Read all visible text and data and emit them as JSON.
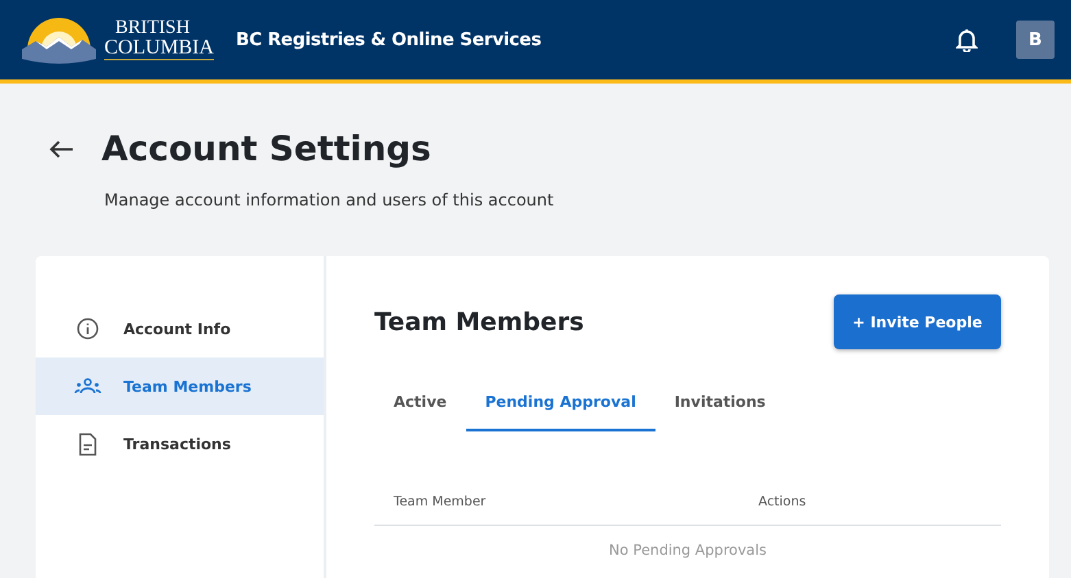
{
  "header": {
    "logo_line_1": "BRITISH",
    "logo_line_2": "COLUMBIA",
    "title": "BC Registries & Online Services",
    "avatar": "B"
  },
  "page": {
    "title": "Account Settings",
    "subtitle": "Manage account information and users of this account"
  },
  "sidebar": {
    "items": [
      {
        "label": "Account Info",
        "kind": "info",
        "selected": false
      },
      {
        "label": "Team Members",
        "kind": "team",
        "selected": true
      },
      {
        "label": "Transactions",
        "kind": "document",
        "selected": false
      }
    ]
  },
  "content": {
    "title": "Team Members",
    "invite_button": "+ Invite People",
    "tabs": [
      {
        "label": "Active",
        "selected": false
      },
      {
        "label": "Pending Approval",
        "selected": true
      },
      {
        "label": "Invitations",
        "selected": false
      }
    ],
    "table": {
      "columns": [
        "Team Member",
        "Actions"
      ],
      "empty_message": "No Pending Approvals"
    }
  }
}
